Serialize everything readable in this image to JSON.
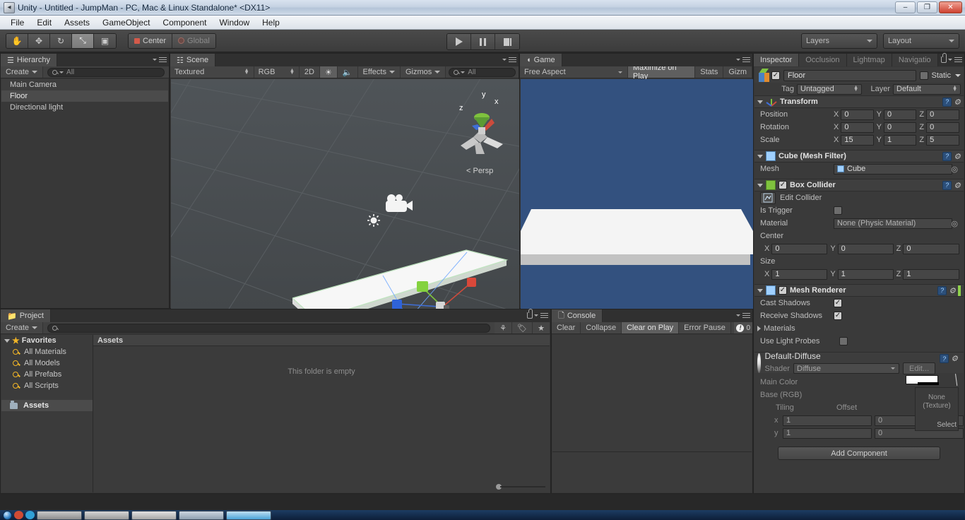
{
  "window": {
    "title": "Unity - Untitled - JumpMan - PC, Mac & Linux Standalone* <DX11>",
    "minimize": "–",
    "restore": "❐",
    "close": "✕"
  },
  "menubar": {
    "items": [
      "File",
      "Edit",
      "Assets",
      "GameObject",
      "Component",
      "Window",
      "Help"
    ]
  },
  "toolbar": {
    "tools": [
      {
        "name": "hand-tool",
        "glyph": "✋",
        "active": false
      },
      {
        "name": "move-tool",
        "glyph": "✥",
        "active": false
      },
      {
        "name": "rotate-tool",
        "glyph": "↻",
        "active": false
      },
      {
        "name": "scale-tool",
        "glyph": "⤡",
        "active": true
      },
      {
        "name": "rect-tool",
        "glyph": "▣",
        "active": false
      }
    ],
    "pivot_label": "Center",
    "space_label": "Global",
    "play_label": "Play",
    "pause_label": "Pause",
    "step_label": "Step",
    "layers_label": "Layers",
    "layout_label": "Layout"
  },
  "hierarchy": {
    "tab": "Hierarchy",
    "create_label": "Create",
    "search_placeholder": "All",
    "items": [
      {
        "label": "Main Camera",
        "selected": false
      },
      {
        "label": "Floor",
        "selected": true
      },
      {
        "label": "Directional light",
        "selected": false
      }
    ]
  },
  "scene": {
    "tab": "Scene",
    "draw_mode": "Textured",
    "color_mode": "RGB",
    "mode_2d": "2D",
    "light_toggle": "☀",
    "audio_toggle": "ὐA",
    "effects_label": "Effects",
    "gizmos_label": "Gizmos",
    "search_placeholder": "All",
    "gizmo_axes": {
      "x": "x",
      "y": "y",
      "z": "z"
    },
    "perspective_label": "Persp"
  },
  "game": {
    "tab": "Game",
    "aspect": "Free Aspect",
    "maximize_on_play": "Maximize on Play",
    "stats": "Stats",
    "gizmos": "Gizm",
    "sky_color": "#33517f",
    "floor_color": "#f4f4f4"
  },
  "project": {
    "tab": "Project",
    "create_label": "Create",
    "search_placeholder": "",
    "favorites_label": "Favorites",
    "favorites": [
      "All Materials",
      "All Models",
      "All Prefabs",
      "All Scripts"
    ],
    "assets_label": "Assets",
    "assets_header": "Assets",
    "empty_message": "This folder is empty"
  },
  "console": {
    "tab": "Console",
    "clear": "Clear",
    "collapse": "Collapse",
    "clear_on_play": "Clear on Play",
    "error_pause": "Error Pause",
    "error_count": "0"
  },
  "inspector": {
    "tabs": [
      "Inspector",
      "Occlusion",
      "Lightmap",
      "Navigatio"
    ],
    "active_tab": "Inspector",
    "object_name": "Floor",
    "object_enabled": true,
    "static_label": "Static",
    "tag_label": "Tag",
    "tag_value": "Untagged",
    "layer_label": "Layer",
    "layer_value": "Default",
    "transform": {
      "title": "Transform",
      "rows": [
        {
          "label": "Position",
          "x": "0",
          "y": "0",
          "z": "0"
        },
        {
          "label": "Rotation",
          "x": "0",
          "y": "0",
          "z": "0"
        },
        {
          "label": "Scale",
          "x": "15",
          "y": "1",
          "z": "5"
        }
      ]
    },
    "mesh_filter": {
      "title": "Cube (Mesh Filter)",
      "mesh_label": "Mesh",
      "mesh_value": "Cube"
    },
    "box_collider": {
      "title": "Box Collider",
      "enabled": true,
      "edit_collider": "Edit Collider",
      "is_trigger_label": "Is Trigger",
      "is_trigger": false,
      "material_label": "Material",
      "material_value": "None (Physic Material)",
      "center_label": "Center",
      "center": {
        "x": "0",
        "y": "0",
        "z": "0"
      },
      "size_label": "Size",
      "size": {
        "x": "1",
        "y": "1",
        "z": "1"
      }
    },
    "mesh_renderer": {
      "title": "Mesh Renderer",
      "enabled": true,
      "cast_shadows_label": "Cast Shadows",
      "cast_shadows": true,
      "receive_shadows_label": "Receive Shadows",
      "receive_shadows": true,
      "materials_label": "Materials",
      "use_light_probes_label": "Use Light Probes",
      "use_light_probes": false
    },
    "material": {
      "name": "Default-Diffuse",
      "shader_label": "Shader",
      "shader_value": "Diffuse",
      "edit_label": "Edit...",
      "main_color_label": "Main Color",
      "main_color": "#ffffff",
      "base_rgb_label": "Base (RGB)",
      "tiling_label": "Tiling",
      "offset_label": "Offset",
      "row_x": "x",
      "row_y": "y",
      "tiling_x": "1",
      "tiling_y": "1",
      "offset_x": "0",
      "offset_y": "0",
      "texture_none_label": "None\n(Texture)",
      "select_label": "Select"
    },
    "add_component": "Add Component"
  }
}
